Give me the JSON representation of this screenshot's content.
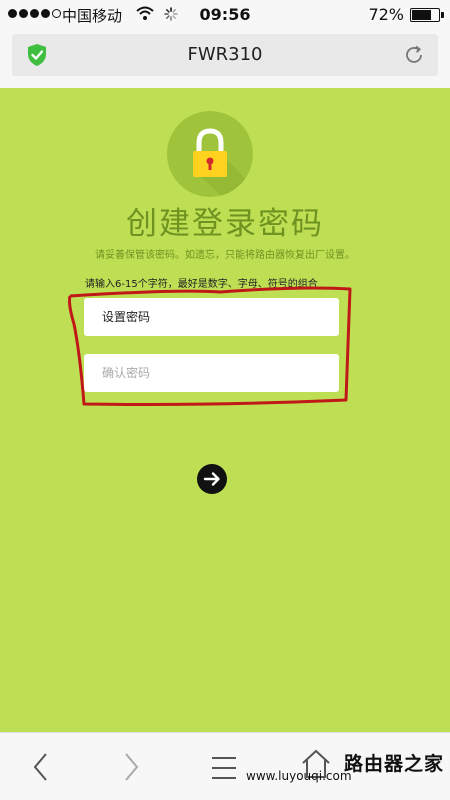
{
  "status_bar": {
    "carrier": "中国移动",
    "time": "09:56",
    "battery_percent": "72%",
    "battery_level": 0.72,
    "signal_bars": 4,
    "signal_total": 5
  },
  "browser": {
    "page_title": "FWR310"
  },
  "page": {
    "title": "创建登录密码",
    "subtitle": "请妥善保管该密码。如遗忘，只能将路由器恢复出厂设置。",
    "hint": "请输入6-15个字符，最好是数字、字母、符号的组合",
    "password_placeholder": "设置密码",
    "confirm_placeholder": "确认密码",
    "accent_color": "#bedf54"
  },
  "watermark": {
    "text": "路由器之家",
    "sub": "www.luyouqi.com"
  }
}
